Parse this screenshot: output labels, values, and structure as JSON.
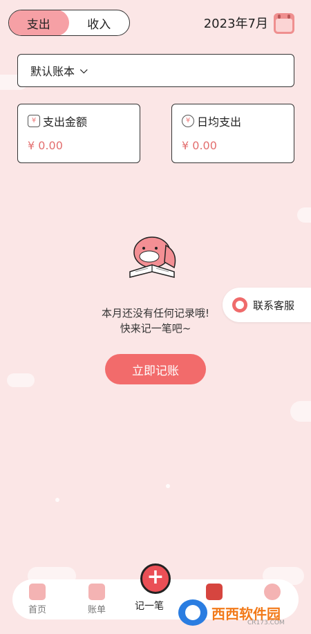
{
  "header": {
    "tabs": [
      {
        "label": "支出",
        "active": true
      },
      {
        "label": "收入",
        "active": false
      }
    ],
    "date": "2023年7月"
  },
  "account": {
    "selected": "默认账本"
  },
  "stats": {
    "expense": {
      "label": "支出金额",
      "value": "¥ 0.00"
    },
    "daily": {
      "label": "日均支出",
      "value": "¥ 0.00"
    }
  },
  "empty": {
    "line1": "本月还没有任何记录哦!",
    "line2": "快来记一笔吧~",
    "button": "立即记账"
  },
  "support": {
    "label": "联系客服"
  },
  "nav": {
    "home": "首页",
    "bills": "账单",
    "add": "记一笔",
    "mine": "",
    "profile": ""
  },
  "watermark": {
    "text": "西西软件园",
    "en": "CR173.COM"
  },
  "colors": {
    "accent": "#f26b6b",
    "background": "#fbe6e6",
    "tab_active": "#f6a0a5"
  }
}
